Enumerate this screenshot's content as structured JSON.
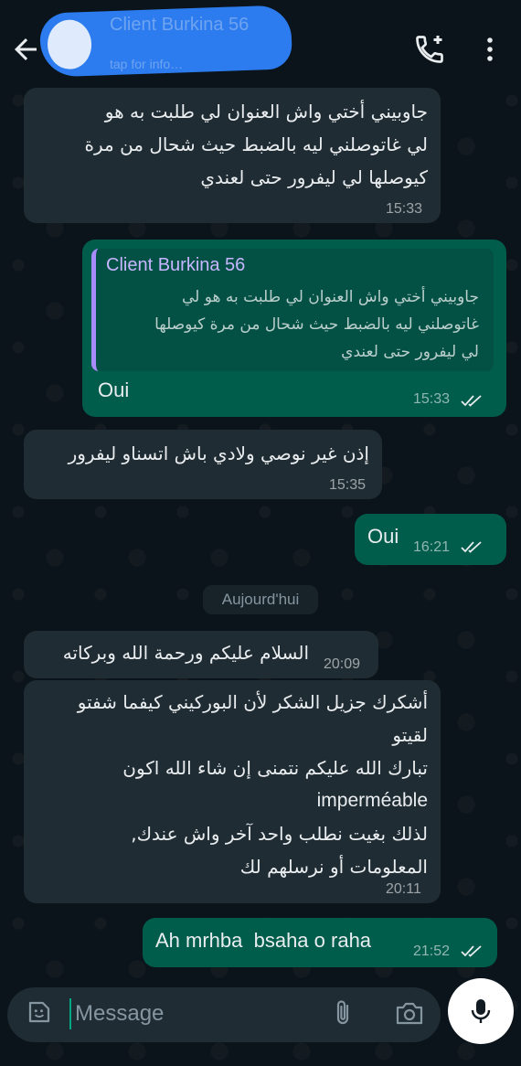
{
  "header": {
    "contact_name": "Client Burkina 56",
    "contact_status": "tap for info…"
  },
  "messages": [
    {
      "direction": "in",
      "lines": [
        "جاوبيني أختي واش العنوان لي طلبت به هو",
        "لي غاتوصلني ليه بالضبط حيث شحال من مرة",
        "كيوصلها لي ليفرور حتى لعندي"
      ],
      "time": "15:33"
    },
    {
      "direction": "out",
      "quote_author": "Client Burkina 56",
      "quote_lines": [
        "جاوبيني أختي واش العنوان لي طلبت به هو لي",
        "غاتوصلني ليه بالضبط حيث شحال من مرة كيوصلها",
        "لي ليفرور حتى لعندي"
      ],
      "text": "Oui",
      "time": "15:33"
    },
    {
      "direction": "in",
      "text": "إذن غير نوصي ولادي باش اتسناو ليفرور",
      "time": "15:35"
    },
    {
      "direction": "out",
      "text": "Oui",
      "time": "16:21"
    },
    {
      "direction": "in",
      "text": "السلام عليكم ورحمة الله وبركاته",
      "time": "20:09"
    },
    {
      "direction": "in",
      "lines": [
        "أشكرك جزيل الشكر لأن البوركيني كيفما شفتو",
        "لقيتو",
        "تبارك الله عليكم نتمنى إن شاء الله اكون",
        "imperméable",
        "لذلك بغيت نطلب واحد آخر واش عندك,",
        "المعلومات أو نرسلهم لك"
      ],
      "time": "20:11"
    },
    {
      "direction": "out",
      "text": "Ah mrhba  bsaha o raha",
      "time": "21:52"
    }
  ],
  "date_divider": "Aujourd'hui",
  "composer": {
    "placeholder": "Message"
  },
  "colors": {
    "incoming_bubble": "#202c33",
    "outgoing_bubble": "#005c4b",
    "background": "#0b141a",
    "accent": "#00a884",
    "read_ticks": "#e9edef"
  },
  "icons": [
    "back-arrow-icon",
    "call-add-icon",
    "more-vert-icon",
    "emoji-icon",
    "attach-icon",
    "camera-icon",
    "mic-icon",
    "double-check-icon"
  ]
}
